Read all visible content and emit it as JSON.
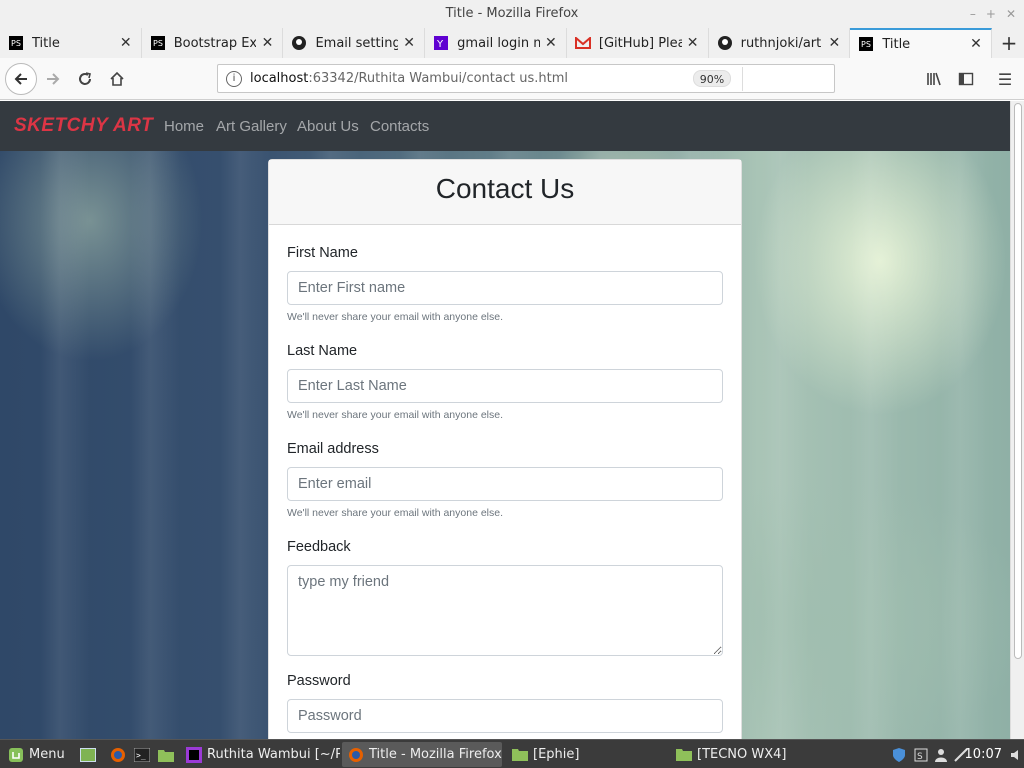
{
  "window": {
    "title": "Title - Mozilla Firefox"
  },
  "tabs": [
    {
      "label": "Title",
      "icon": "pycharm-icon"
    },
    {
      "label": "Bootstrap Exa",
      "icon": "pycharm-icon"
    },
    {
      "label": "Email settings",
      "icon": "github-icon"
    },
    {
      "label": "gmail login ma",
      "icon": "yahoo-icon"
    },
    {
      "label": "[GitHub] Pleas",
      "icon": "gmail-icon"
    },
    {
      "label": "ruthnjoki/art",
      "icon": "github-icon"
    },
    {
      "label": "Title",
      "icon": "pycharm-icon"
    }
  ],
  "address_bar": {
    "host": "localhost",
    "rest": ":63342/Ruthita Wambui/contact us.html",
    "zoom": "90%"
  },
  "site": {
    "brand": "SKETCHY ART",
    "nav": [
      "Home",
      "Art Gallery",
      "About Us",
      "Contacts"
    ]
  },
  "form": {
    "title": "Contact Us",
    "first_name": {
      "label": "First Name",
      "placeholder": "Enter First name",
      "help": "We'll never share your email with anyone else."
    },
    "last_name": {
      "label": "Last Name",
      "placeholder": "Enter Last Name",
      "help": "We'll never share your email with anyone else."
    },
    "email": {
      "label": "Email address",
      "placeholder": "Enter email",
      "help": "We'll never share your email with anyone else."
    },
    "feedback": {
      "label": "Feedback",
      "placeholder": "type my friend"
    },
    "password": {
      "label": "Password",
      "placeholder": "Password"
    }
  },
  "taskbar": {
    "menu": "Menu",
    "windows": [
      "Ruthita Wambui [~/P...",
      "Title - Mozilla Firefox",
      "[Ephie]",
      "[TECNO WX4]"
    ],
    "clock": "10:07"
  },
  "colors": {
    "brand": "#dc3545",
    "navbar": "#343a40",
    "tab_accent": "#3a9bd9"
  }
}
